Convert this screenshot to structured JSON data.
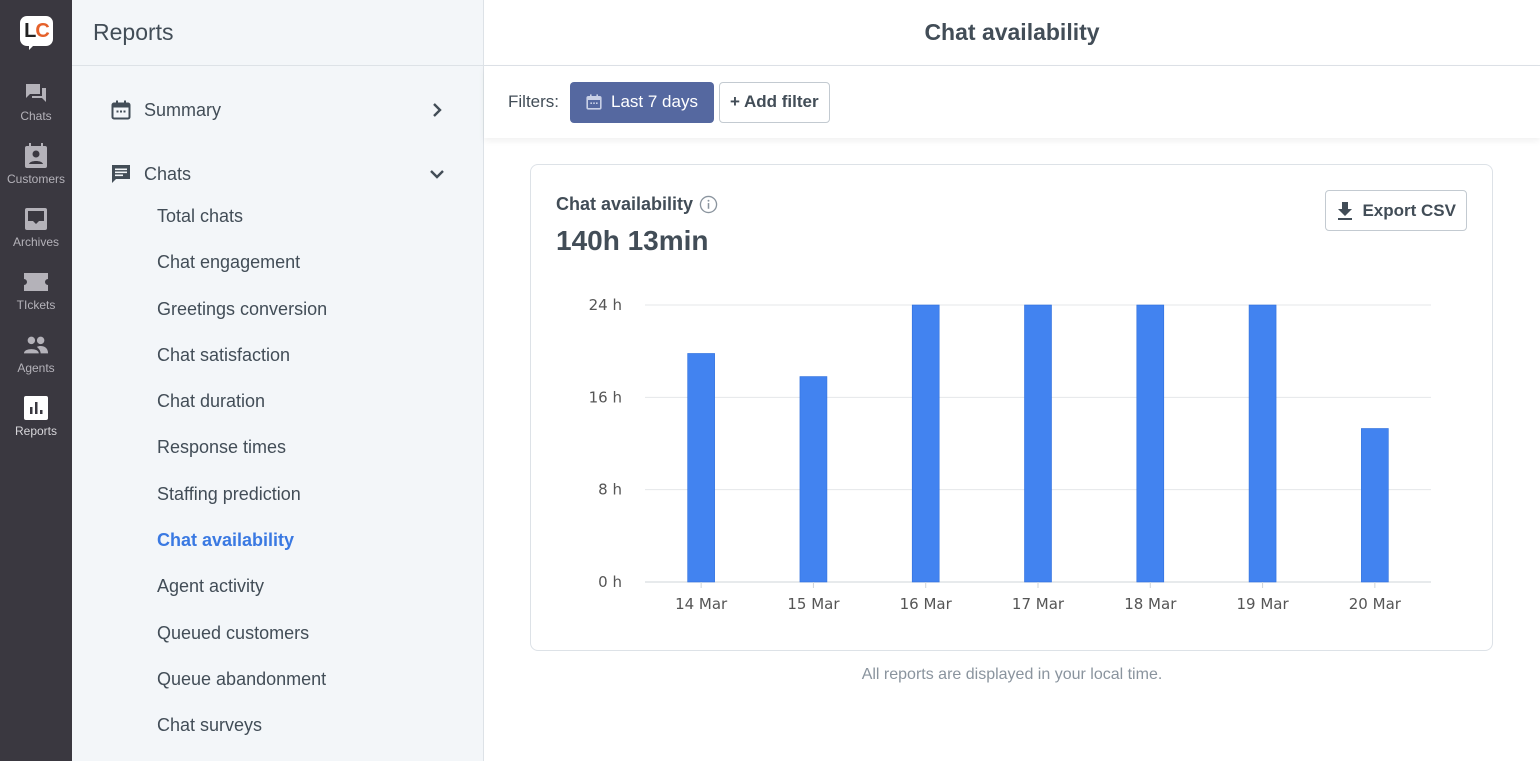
{
  "rail": {
    "logo": {
      "l": "L",
      "c": "C"
    },
    "items": [
      {
        "id": "chats",
        "label": "Chats",
        "icon": "chats-icon"
      },
      {
        "id": "customers",
        "label": "Customers",
        "icon": "customers-icon"
      },
      {
        "id": "archives",
        "label": "Archives",
        "icon": "archives-icon"
      },
      {
        "id": "tickets",
        "label": "TIckets",
        "icon": "tickets-icon"
      },
      {
        "id": "agents",
        "label": "Agents",
        "icon": "agents-icon"
      },
      {
        "id": "reports",
        "label": "Reports",
        "icon": "reports-icon",
        "active": true
      }
    ]
  },
  "sidebar": {
    "title": "Reports",
    "sections": [
      {
        "label": "Summary",
        "icon": "calendar-icon",
        "expanded": false
      },
      {
        "label": "Chats",
        "icon": "chat-message-icon",
        "expanded": true
      }
    ],
    "chat_items": [
      "Total chats",
      "Chat engagement",
      "Greetings conversion",
      "Chat satisfaction",
      "Chat duration",
      "Response times",
      "Staffing prediction",
      "Chat availability",
      "Agent activity",
      "Queued customers",
      "Queue abandonment",
      "Chat surveys"
    ],
    "active_item": "Chat availability"
  },
  "header": {
    "title": "Chat availability"
  },
  "filters": {
    "label": "Filters:",
    "date_range": "Last 7 days",
    "add_filter": "+ Add filter"
  },
  "card": {
    "title": "Chat availability",
    "total": "140h 13min",
    "export_label": "Export CSV"
  },
  "footnote": "All reports are displayed in your local time.",
  "colors": {
    "bar": "#4283f0",
    "accent_link": "#3a79e2",
    "date_button": "#5568a0",
    "rail_bg": "#3a3840",
    "logo_c": "#e5612b"
  },
  "chart_data": {
    "type": "bar",
    "title": "Chat availability",
    "categories": [
      "14 Mar",
      "15 Mar",
      "16 Mar",
      "17 Mar",
      "18 Mar",
      "19 Mar",
      "20 Mar"
    ],
    "values": [
      19.8,
      17.8,
      24,
      24,
      24,
      24,
      13.3
    ],
    "unit": "h",
    "yticks": [
      0,
      8,
      16,
      24
    ],
    "ytick_labels": [
      "0 h",
      "8 h",
      "16 h",
      "24 h"
    ],
    "ylim": [
      0,
      24
    ],
    "xlabel": "",
    "ylabel": "",
    "grid": true,
    "legend": "none"
  }
}
